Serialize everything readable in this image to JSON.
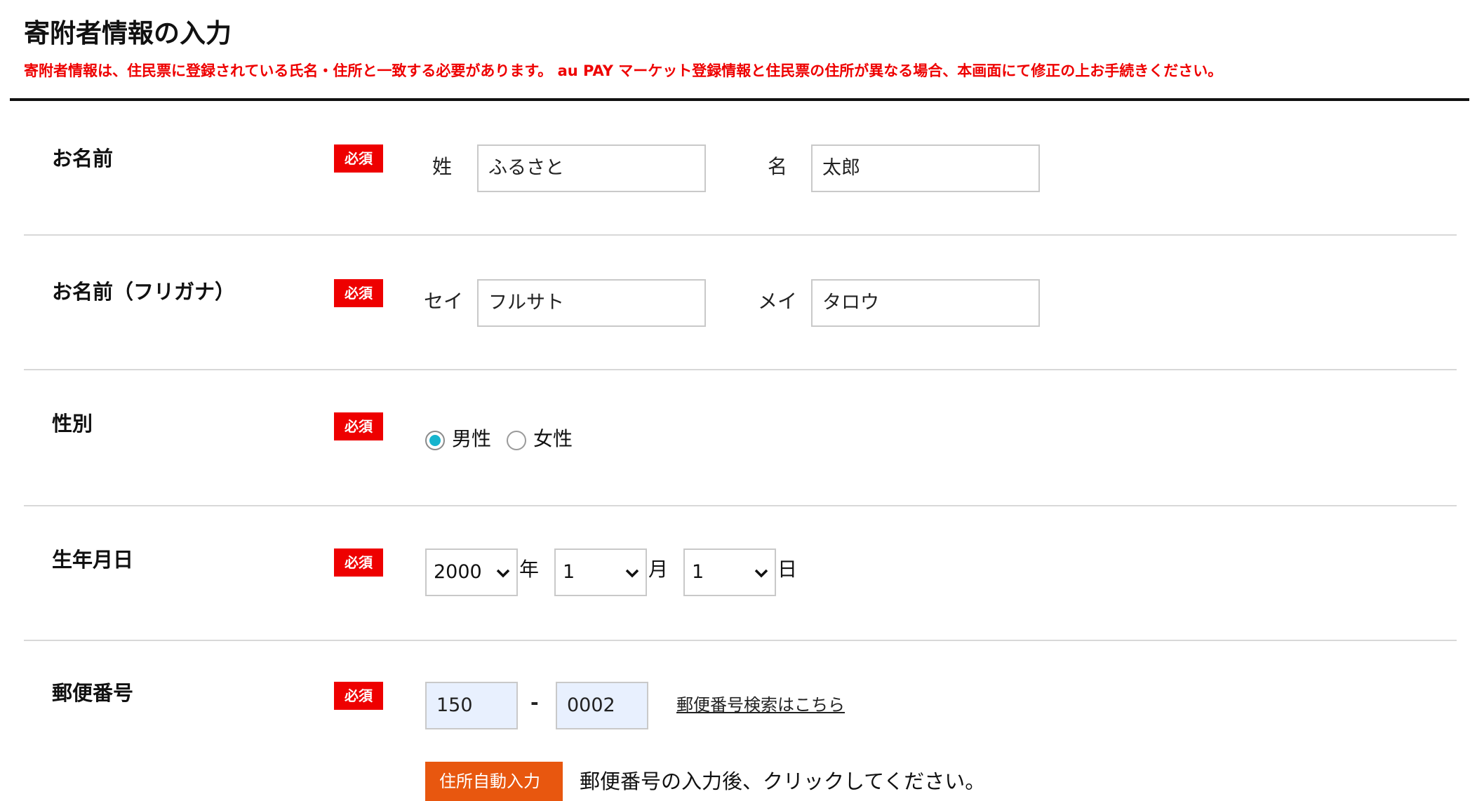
{
  "header": {
    "title": "寄附者情報の入力",
    "notice": "寄附者情報は、住民票に登録されている氏名・住所と一致する必要があります。 au PAY マーケット登録情報と住民票の住所が異なる場合、本画面にて修正の上お手続きください。"
  },
  "required_label": "必須",
  "name": {
    "label": "お名前",
    "last_label": "姓",
    "last_value": "ふるさと",
    "first_label": "名",
    "first_value": "太郎"
  },
  "kana": {
    "label": "お名前（フリガナ）",
    "last_label": "セイ",
    "last_value": "フルサト",
    "first_label": "メイ",
    "first_value": "タロウ"
  },
  "gender": {
    "label": "性別",
    "options": [
      "男性",
      "女性"
    ],
    "selected": "男性"
  },
  "birthdate": {
    "label": "生年月日",
    "year": "2000",
    "year_unit": "年",
    "month": "1",
    "month_unit": "月",
    "day": "1",
    "day_unit": "日"
  },
  "postal": {
    "label": "郵便番号",
    "part1": "150",
    "separator": "-",
    "part2": "0002",
    "search_link": "郵便番号検索はこちら",
    "autofill_button": "住所自動入力",
    "autofill_hint": "郵便番号の入力後、クリックしてください。"
  },
  "colors": {
    "required_bg": "#ee0000",
    "notice_text": "#ee0000",
    "radio_selected": "#16b4cd",
    "autofill_button_bg": "#e8570f",
    "zip_input_bg": "#e8f0fe"
  }
}
